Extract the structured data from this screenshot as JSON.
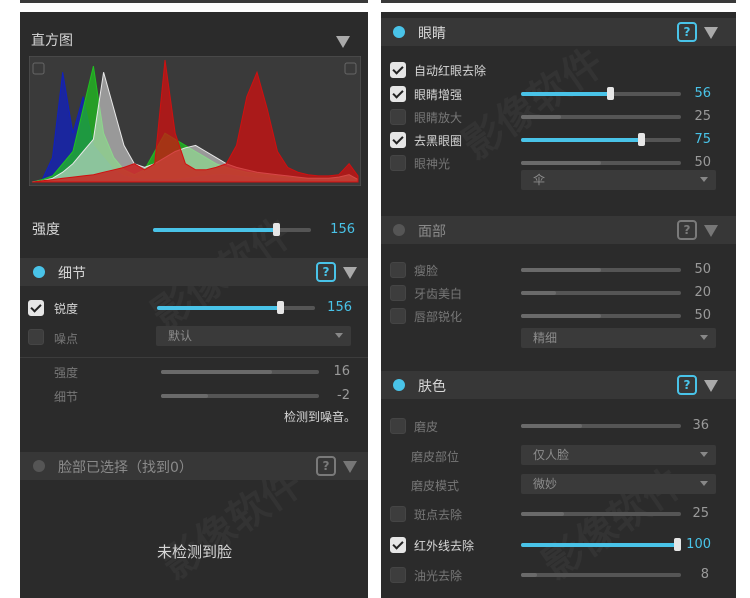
{
  "left": {
    "histogram": {
      "title": "直方图",
      "chart_data": {
        "type": "area",
        "title": "直方图",
        "x": [
          0,
          8,
          16,
          24,
          32,
          40,
          48,
          56,
          64,
          72,
          80,
          88,
          96,
          104,
          112,
          120,
          128,
          136,
          144,
          152,
          160,
          168,
          176,
          184,
          192,
          200,
          208,
          216,
          224,
          232,
          240,
          248,
          255
        ],
        "series": [
          {
            "color": "#1020c0",
            "values": [
              0,
              2,
              20,
              90,
              40,
              70,
              30,
              20,
              10,
              5,
              3,
              2,
              2,
              2,
              2,
              3,
              4,
              5,
              6,
              6,
              5,
              4,
              3,
              3,
              3,
              3,
              2,
              2,
              2,
              2,
              3,
              5,
              2
            ]
          },
          {
            "color": "#20c020",
            "values": [
              0,
              2,
              5,
              15,
              25,
              60,
              95,
              40,
              20,
              10,
              6,
              10,
              25,
              40,
              35,
              30,
              25,
              20,
              15,
              12,
              10,
              8,
              7,
              6,
              5,
              4,
              3,
              3,
              3,
              3,
              4,
              6,
              2
            ]
          },
          {
            "color": "#e8e8e8",
            "values": [
              0,
              1,
              3,
              8,
              15,
              25,
              35,
              90,
              60,
              30,
              15,
              12,
              15,
              20,
              25,
              28,
              30,
              25,
              20,
              15,
              12,
              10,
              8,
              7,
              6,
              5,
              4,
              3,
              3,
              3,
              4,
              6,
              2
            ]
          },
          {
            "color": "#d01010",
            "values": [
              0,
              1,
              2,
              3,
              4,
              5,
              6,
              8,
              10,
              12,
              15,
              10,
              15,
              100,
              40,
              15,
              10,
              10,
              12,
              15,
              30,
              70,
              90,
              60,
              25,
              12,
              8,
              6,
              5,
              5,
              6,
              15,
              5
            ]
          }
        ]
      }
    },
    "strength": {
      "label": "强度",
      "value": "156",
      "level": 0.78
    },
    "detail": {
      "title": "细节",
      "sharpen": {
        "label": "锐度",
        "value": "156",
        "level": 0.78
      },
      "noise": {
        "label": "噪点",
        "select": "默认"
      },
      "noise_strength": {
        "label": "强度",
        "value": "16",
        "level": 0.7
      },
      "noise_detail": {
        "label": "细节",
        "value": "-2",
        "level": 0.3
      },
      "note": "检测到噪音。"
    },
    "face": {
      "title": "脸部已选择（找到0）",
      "empty": "未检测到脸"
    }
  },
  "right": {
    "eyes": {
      "title": "眼睛",
      "auto_red": "自动红眼去除",
      "rows": [
        {
          "label": "眼睛增强",
          "value": "56",
          "level": 0.56,
          "checked": true
        },
        {
          "label": "眼睛放大",
          "value": "25",
          "level": 0.25,
          "checked": false
        },
        {
          "label": "去黑眼圈",
          "value": "75",
          "level": 0.75,
          "checked": true
        },
        {
          "label": "眼神光",
          "value": "50",
          "level": 0.5,
          "checked": false
        }
      ],
      "select": "伞"
    },
    "face": {
      "title": "面部",
      "rows": [
        {
          "label": "瘦脸",
          "value": "50",
          "level": 0.5
        },
        {
          "label": "牙齿美白",
          "value": "20",
          "level": 0.22
        },
        {
          "label": "唇部锐化",
          "value": "50",
          "level": 0.5
        }
      ],
      "select": "精细"
    },
    "skin": {
      "title": "肤色",
      "smooth": {
        "label": "磨皮",
        "value": "36",
        "level": 0.38
      },
      "area": {
        "label": "磨皮部位",
        "select": "仅人脸"
      },
      "mode": {
        "label": "磨皮模式",
        "select": "微妙"
      },
      "spot": {
        "label": "斑点去除",
        "value": "25",
        "level": 0.27
      },
      "infrared": {
        "label": "红外线去除",
        "value": "100",
        "level": 1.0
      },
      "oil": {
        "label": "油光去除",
        "value": "8",
        "level": 0.1
      }
    }
  },
  "help_symbol": "?"
}
